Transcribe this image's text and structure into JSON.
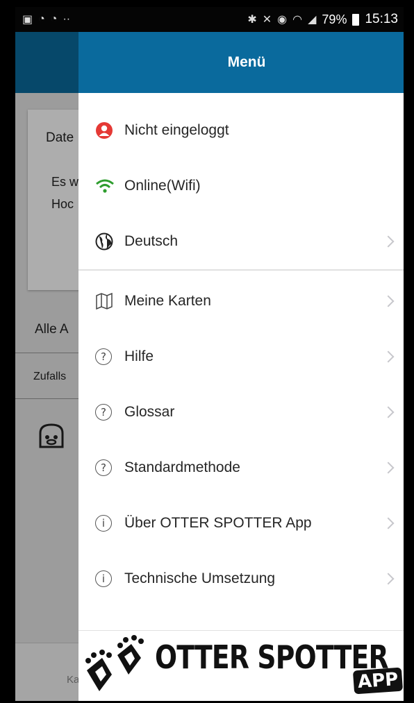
{
  "statusbar": {
    "battery": "79%",
    "time": "15:13"
  },
  "background": {
    "card_title": "Date",
    "card_line1": "Es w",
    "card_line2": "Hoc",
    "list_header": "Alle A",
    "list_sub": "Zufalls",
    "bottom_tab": "Ka"
  },
  "drawer": {
    "title": "Menü",
    "items": [
      {
        "label": "Nicht eingeloggt",
        "icon": "user-icon",
        "chevron": false
      },
      {
        "label": "Online(Wifi)",
        "icon": "wifi-icon",
        "chevron": false
      },
      {
        "label": "Deutsch",
        "icon": "globe-icon",
        "chevron": true
      },
      {
        "label": "Meine Karten",
        "icon": "map-icon",
        "chevron": true
      },
      {
        "label": "Hilfe",
        "icon": "help-icon",
        "chevron": true
      },
      {
        "label": "Glossar",
        "icon": "help-icon",
        "chevron": true
      },
      {
        "label": "Standardmethode",
        "icon": "help-icon",
        "chevron": true
      },
      {
        "label": "Über OTTER SPOTTER App",
        "icon": "info-icon",
        "chevron": true
      },
      {
        "label": "Technische Umsetzung",
        "icon": "info-icon",
        "chevron": true
      }
    ]
  },
  "logo": {
    "text": "OTTER SPOTTER",
    "badge": "APP"
  },
  "colors": {
    "header": "#0a6a9d",
    "user_icon": "#e53935",
    "wifi_icon": "#2e9d2e"
  }
}
